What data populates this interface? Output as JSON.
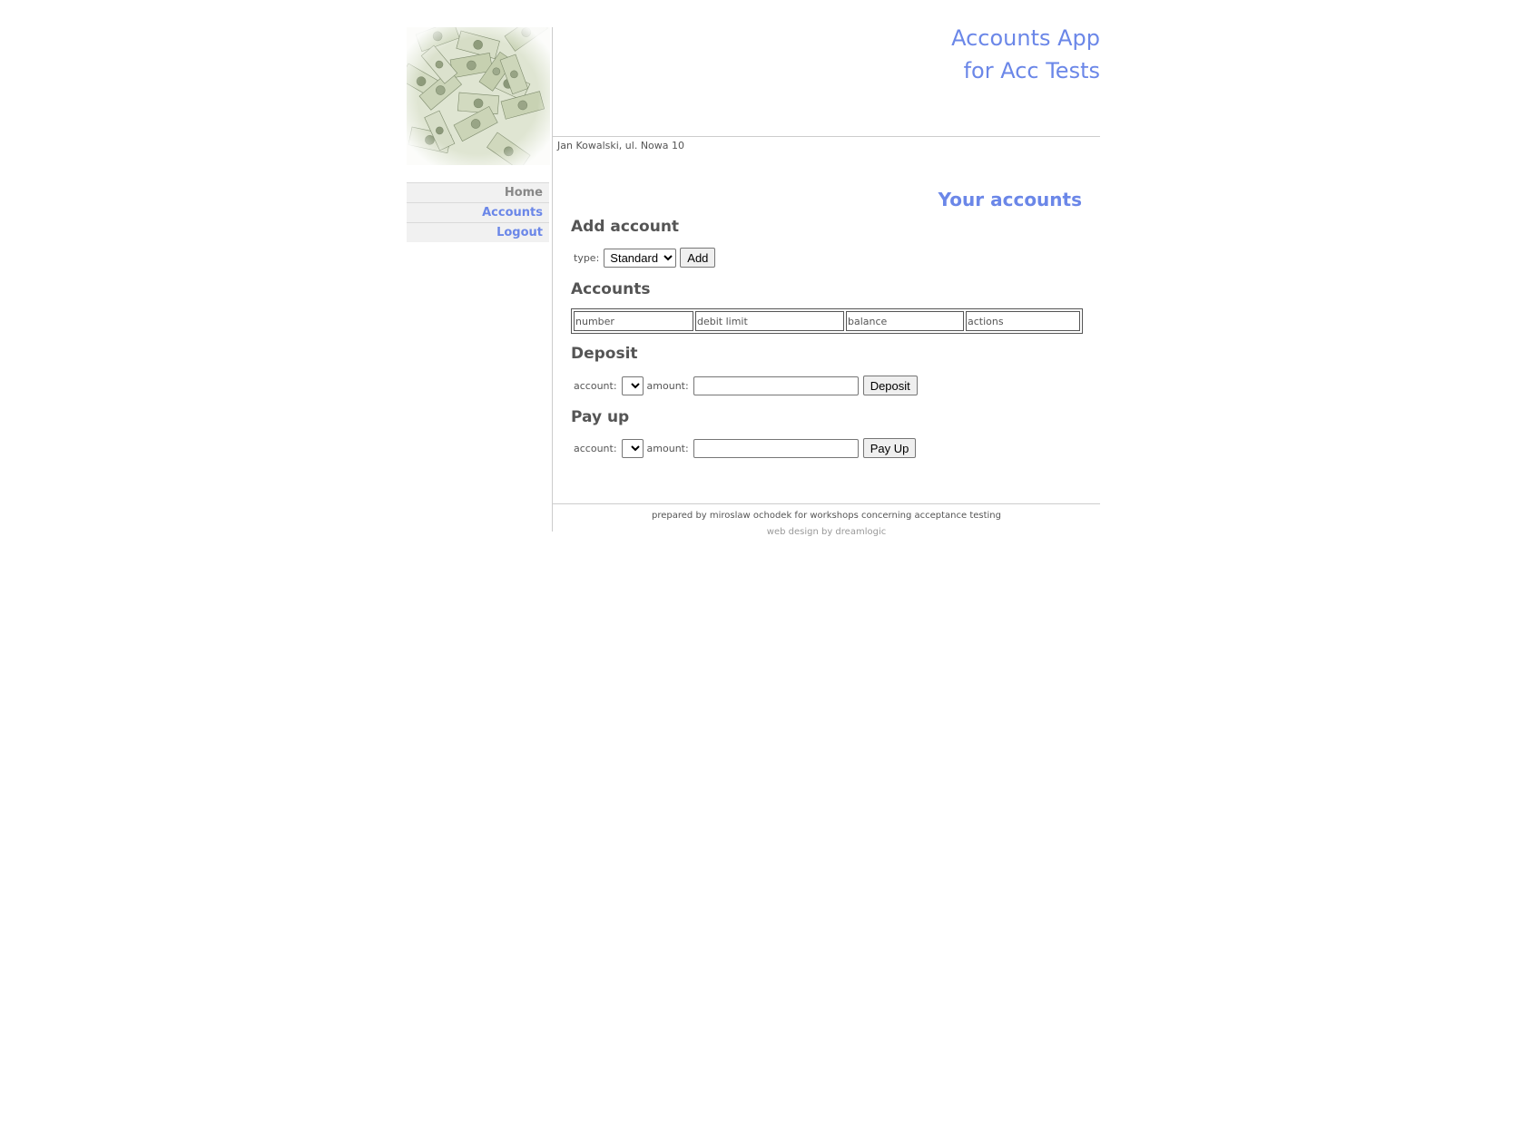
{
  "app": {
    "title_line1": "Accounts App",
    "title_line2": "for Acc Tests"
  },
  "user": {
    "info": "Jan Kowalski, ul. Nowa 10"
  },
  "sidebar": {
    "logo_icon": "money-collage-icon",
    "items": [
      {
        "label": "Home",
        "state": "normal"
      },
      {
        "label": "Accounts",
        "state": "active"
      },
      {
        "label": "Logout",
        "state": "link"
      }
    ]
  },
  "main": {
    "heading": "Your accounts",
    "add_account": {
      "title": "Add account",
      "type_label": "type:",
      "type_selected": "Standard",
      "add_button": "Add"
    },
    "accounts": {
      "title": "Accounts",
      "columns": [
        "number",
        "debit limit",
        "balance",
        "actions"
      ],
      "rows": []
    },
    "deposit": {
      "title": "Deposit",
      "account_label": "account:",
      "account_selected": "",
      "amount_label": "amount:",
      "amount_value": "",
      "button": "Deposit"
    },
    "payup": {
      "title": "Pay up",
      "account_label": "account:",
      "account_selected": "",
      "amount_label": "amount:",
      "amount_value": "",
      "button": "Pay Up"
    }
  },
  "footer": {
    "line1": "prepared by miroslaw ochodek for workshops concerning acceptance testing",
    "line2": "web design by dreamlogic"
  },
  "colors": {
    "accent": "#6b87e8",
    "text": "#555555",
    "rule": "#cccccc"
  }
}
